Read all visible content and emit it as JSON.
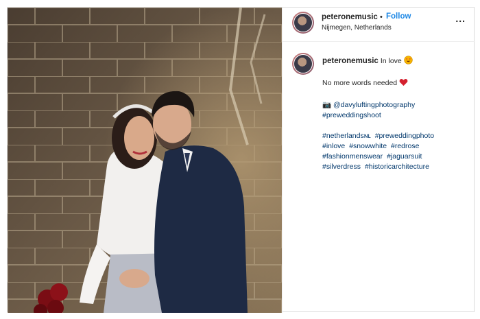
{
  "header": {
    "username": "peteronemusic",
    "separator": "•",
    "follow_label": "Follow",
    "location": "Nijmegen, Netherlands",
    "more_label": "..."
  },
  "caption": {
    "username": "peteronemusic",
    "text": "In love",
    "line2": "No more words needed",
    "camera_emoji": "📷",
    "photographer": "@davyluftingphotography",
    "tag_preweddingshoot": "#preweddingshoot",
    "hashtags": [
      "#netherlandsɴʟ",
      "#preweddingphoto",
      "#inlove",
      "#snowwhite",
      "#redrose",
      "#fashionmenswear",
      "#jaguarsuit",
      "#silverdress",
      "#historicarchitecture"
    ]
  },
  "icons": {
    "emoji_in_love": "smiling-face-with-heart-eyes-icon",
    "emoji_heart": "red-heart-icon",
    "more": "ellipsis-icon"
  },
  "colors": {
    "follow": "#1e88e5",
    "hashtag": "#00376b",
    "border": "#dbdbdb"
  }
}
